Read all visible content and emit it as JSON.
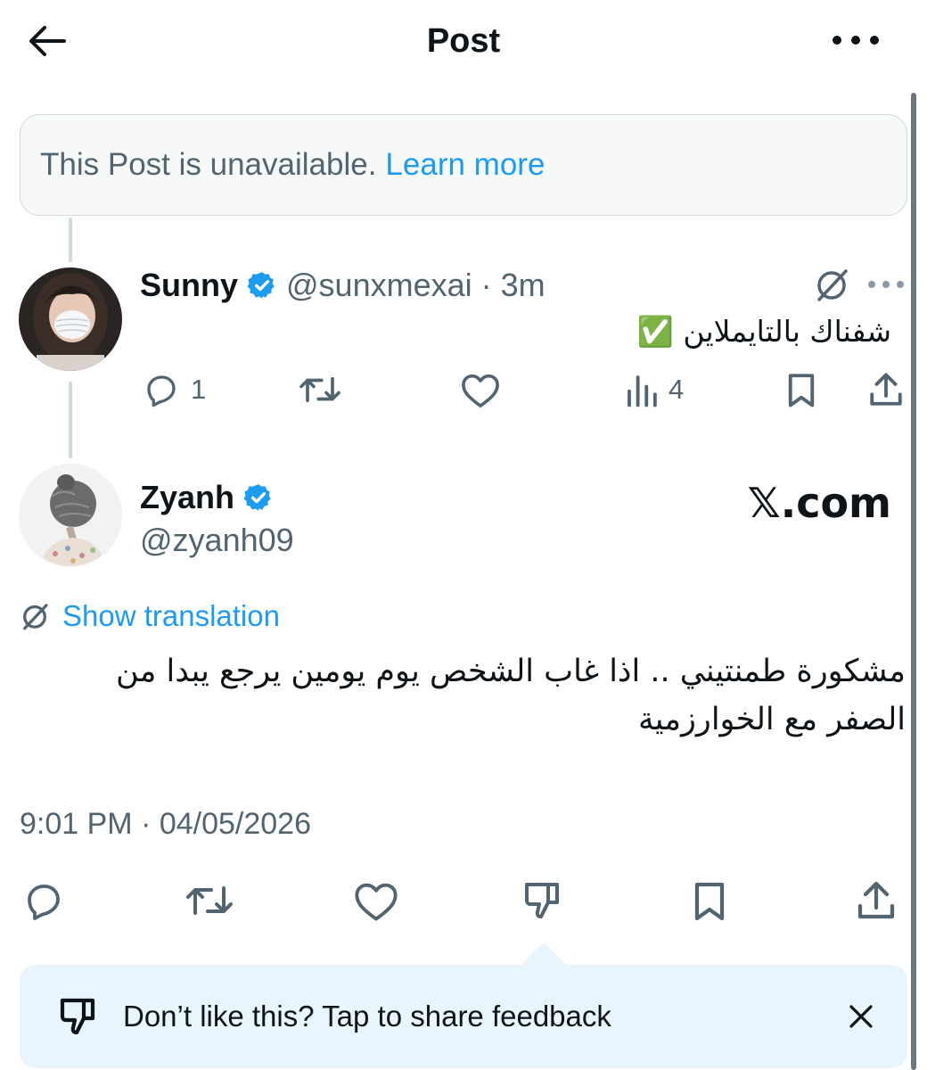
{
  "header": {
    "title": "Post"
  },
  "unavailable": {
    "text": "This Post is unavailable.",
    "link": "Learn more"
  },
  "reply": {
    "name": "Sunny",
    "handle": "@sunxmexai",
    "separator": "·",
    "time": "3m",
    "text": "شفناك بالتايملاين ✅",
    "replies": "1",
    "views": "4"
  },
  "post": {
    "name": "Zyanh",
    "handle": "@zyanh09",
    "watermark": "𝕏.com",
    "translate_label": "Show translation",
    "text_line1": "مشكورة طمنتيني .. اذا غاب الشخص يوم يومين يرجع يبدا من",
    "text_line2": "الصفر مع الخوارزمية",
    "timestamp": "9:01 PM · 04/05/2026"
  },
  "feedback": {
    "text": "Don’t like this? Tap to share feedback"
  },
  "colors": {
    "accent": "#1d9bf0",
    "muted": "#536471",
    "feedback_bg": "#e8f5fd"
  }
}
